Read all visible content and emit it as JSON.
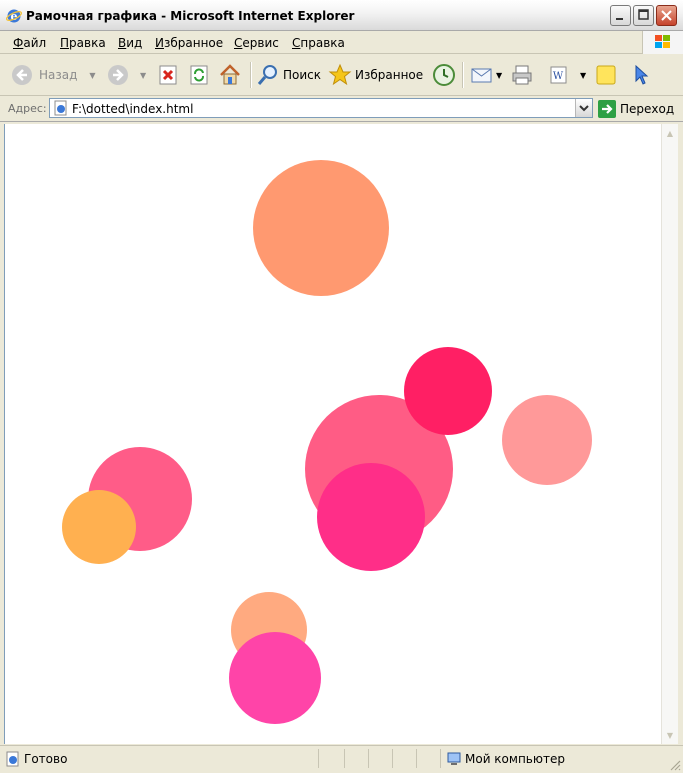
{
  "window": {
    "title": "Рамочная графика - Microsoft Internet Explorer"
  },
  "menu": {
    "items": [
      {
        "label": "Файл",
        "hotkey": "Ф",
        "rest": "айл"
      },
      {
        "label": "Правка",
        "hotkey": "П",
        "rest": "равка"
      },
      {
        "label": "Вид",
        "hotkey": "В",
        "rest": "ид"
      },
      {
        "label": "Избранное",
        "hotkey": "И",
        "rest": "збранное"
      },
      {
        "label": "Сервис",
        "hotkey": "С",
        "rest": "ервис"
      },
      {
        "label": "Справка",
        "hotkey": "С",
        "rest": "правка"
      }
    ]
  },
  "toolbar": {
    "back_label": "Назад",
    "search_label": "Поиск",
    "favorites_label": "Избранное"
  },
  "address": {
    "label": "Адрес:",
    "value": "F:\\dotted\\index.html",
    "go_label": "Переход"
  },
  "status": {
    "text": "Готово",
    "zone": "Мой компьютер"
  },
  "page": {
    "circles": [
      {
        "color": "#FF9970"
      },
      {
        "color": "#FF5C85"
      },
      {
        "color": "#FF1F64"
      },
      {
        "color": "#FF9999"
      },
      {
        "color": "#FF2E88"
      },
      {
        "color": "#FF5C88"
      },
      {
        "color": "#FFB050"
      },
      {
        "color": "#FFAA80"
      },
      {
        "color": "#FF44A8"
      }
    ]
  }
}
